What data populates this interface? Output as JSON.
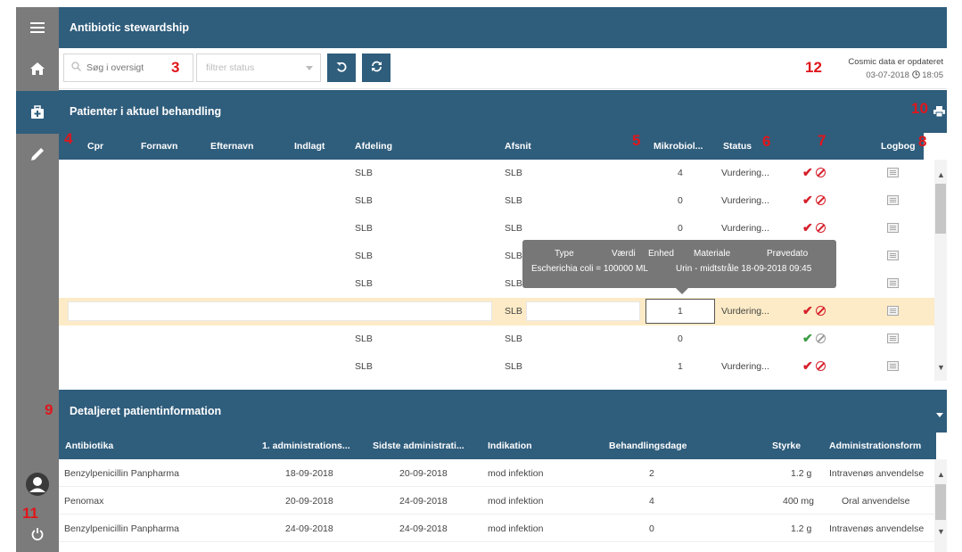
{
  "app": {
    "title": "Antibiotic stewardship"
  },
  "sidebar": {
    "items": [
      "menu-icon",
      "home-icon",
      "medical-kit-icon",
      "pen-icon"
    ],
    "bottom": [
      "user-icon",
      "power-icon"
    ]
  },
  "toolbar": {
    "search_placeholder": "Søg i oversigt",
    "status_placeholder": "filtrer status",
    "cosmic_line1": "Cosmic data er opdateret",
    "cosmic_date": "03-07-2018",
    "cosmic_time": "18:05"
  },
  "annotations": {
    "a3": "3",
    "a4": "4",
    "a5": "5",
    "a6": "6",
    "a7": "7",
    "a8": "8",
    "a9": "9",
    "a10": "10",
    "a11": "11",
    "a12": "12"
  },
  "patients": {
    "title": "Patienter i aktuel behandling",
    "columns": {
      "cpr": "Cpr",
      "fornavn": "Fornavn",
      "efternavn": "Efternavn",
      "indlagt": "Indlagt",
      "afdeling": "Afdeling",
      "afsnit": "Afsnit",
      "mikro": "Mikrobiol...",
      "status": "Status",
      "logbog": "Logbog"
    },
    "rows": [
      {
        "afdeling": "SLB",
        "afsnit": "SLB",
        "mikro": "4",
        "status": "Vurdering...",
        "flag": "red"
      },
      {
        "afdeling": "SLB",
        "afsnit": "SLB",
        "mikro": "0",
        "status": "Vurdering...",
        "flag": "red"
      },
      {
        "afdeling": "SLB",
        "afsnit": "SLB",
        "mikro": "0",
        "status": "Vurdering...",
        "flag": "red"
      },
      {
        "afdeling": "SLB",
        "afsnit": "SLB",
        "mikro": "",
        "status": "",
        "flag": ""
      },
      {
        "afdeling": "SLB",
        "afsnit": "SLB",
        "mikro": "",
        "status": "",
        "flag": ""
      },
      {
        "afdeling": "",
        "afsnit": "SLB",
        "mikro": "1",
        "status": "Vurdering...",
        "flag": "red"
      },
      {
        "afdeling": "SLB",
        "afsnit": "SLB",
        "mikro": "0",
        "status": "",
        "flag": "green"
      },
      {
        "afdeling": "SLB",
        "afsnit": "SLB",
        "mikro": "1",
        "status": "Vurdering...",
        "flag": "red"
      }
    ]
  },
  "tooltip": {
    "type": "Type",
    "vaerdi": "Værdi",
    "enhed": "Enhed",
    "materiale": "Materiale",
    "proevedato": "Prøvedato",
    "value_left": "Escherichia coli = 100000 ML",
    "value_right": "Urin - midtstråle 18-09-2018 09:45"
  },
  "details": {
    "title": "Detaljeret patientinformation",
    "columns": {
      "antibiotika": "Antibiotika",
      "first": "1. administrations...",
      "last": "Sidste administrati...",
      "indikation": "Indikation",
      "dage": "Behandlingsdage",
      "styrke": "Styrke",
      "form": "Administrationsform"
    },
    "rows": [
      {
        "antibiotika": "Benzylpenicillin Panpharma",
        "first": "18-09-2018",
        "last": "20-09-2018",
        "indikation": "mod infektion",
        "dage": "2",
        "styrke": "1.2 g",
        "form": "Intravenøs anvendelse"
      },
      {
        "antibiotika": "Penomax",
        "first": "20-09-2018",
        "last": "24-09-2018",
        "indikation": "mod infektion",
        "dage": "4",
        "styrke": "400 mg",
        "form": "Oral anvendelse"
      },
      {
        "antibiotika": "Benzylpenicillin Panpharma",
        "first": "24-09-2018",
        "last": "24-09-2018",
        "indikation": "mod infektion",
        "dage": "0",
        "styrke": "1.2 g",
        "form": "Intravenøs anvendelse"
      }
    ]
  },
  "colors": {
    "header": "#2f5d7c",
    "sidebar": "#7b7b7b",
    "annotation": "#e0161b",
    "selected_row": "#fcebc6",
    "check_red": "#d61f2a",
    "check_green": "#3a9c43"
  }
}
